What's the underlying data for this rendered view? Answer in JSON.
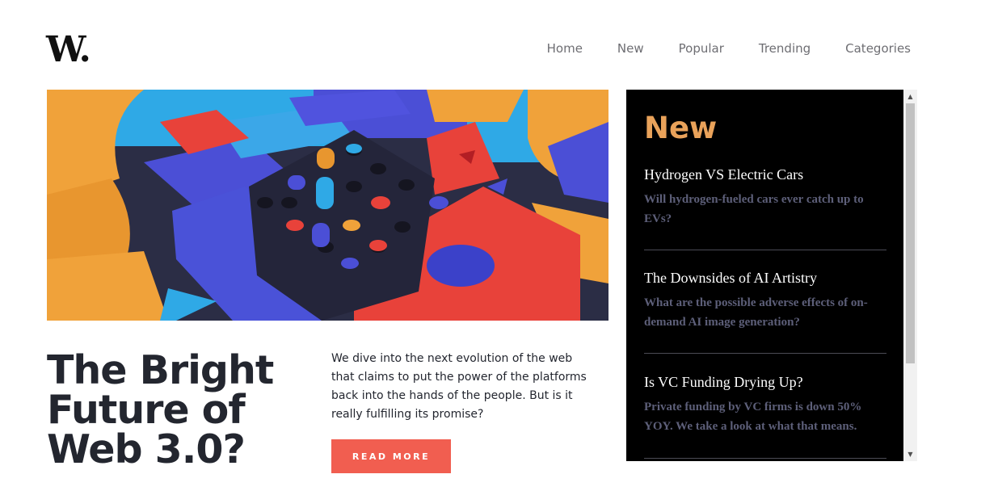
{
  "logo": {
    "text": "W."
  },
  "nav": {
    "items": [
      {
        "label": "Home"
      },
      {
        "label": "New"
      },
      {
        "label": "Popular"
      },
      {
        "label": "Trending"
      },
      {
        "label": "Categories"
      }
    ]
  },
  "hero": {
    "image": "colorful-3d-blocks-image",
    "headline": "The Bright Future of Web 3.0?",
    "description": "We dive into the next evolution of the web that claims to put the power of the platforms back into the hands of the people. But is it really fulfilling its promise?",
    "button_label": "READ MORE"
  },
  "new_panel": {
    "title": "New",
    "items": [
      {
        "title": "Hydrogen VS Electric Cars",
        "summary": "Will hydrogen-fueled cars ever catch up to EVs?"
      },
      {
        "title": "The Downsides of AI Artistry",
        "summary": "What are the possible adverse effects of on-demand AI image generation?"
      },
      {
        "title": "Is VC Funding Drying Up?",
        "summary": "Private funding by VC firms is down 50% YOY. We take a look at what that means."
      }
    ]
  },
  "colors": {
    "accent": "#f15e50",
    "panel_title": "#e9a25a",
    "panel_bg": "#000000",
    "summary_text": "#5d5f79",
    "heading_text": "#23262f"
  }
}
